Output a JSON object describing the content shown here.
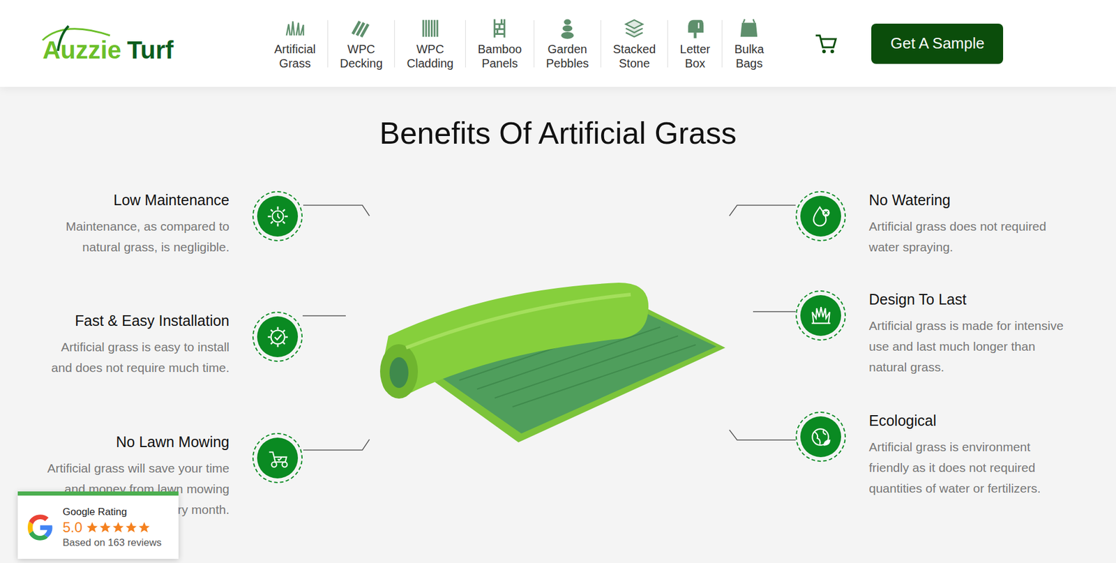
{
  "logo": {
    "name": "Auzzie",
    "accent": "Turf"
  },
  "nav": [
    {
      "label": "Artificial Grass"
    },
    {
      "label": "WPC Decking"
    },
    {
      "label": "WPC Cladding"
    },
    {
      "label": "Bamboo Panels"
    },
    {
      "label": "Garden Pebbles"
    },
    {
      "label": "Stacked Stone"
    },
    {
      "label": "Letter Box"
    },
    {
      "label": "Bulka Bags"
    }
  ],
  "cta": "Get A Sample",
  "title": "Benefits Of Artificial Grass",
  "left": [
    {
      "title": "Low Maintenance",
      "desc": "Maintenance, as compared to natural grass, is negligible."
    },
    {
      "title": "Fast & Easy Installation",
      "desc": "Artificial grass is easy to install and does not require much time."
    },
    {
      "title": "No Lawn Mowing",
      "desc": "Artificial grass will save your time and money from lawn mowing every month."
    }
  ],
  "right": [
    {
      "title": "No Watering",
      "desc": "Artificial grass does not required water spraying."
    },
    {
      "title": "Design To Last",
      "desc": "Artificial grass is made for intensive use and last much longer than natural grass."
    },
    {
      "title": "Ecological",
      "desc": "Artificial grass is environment friendly as it does not required quantities of water or fertilizers."
    }
  ],
  "badge": {
    "label": "Google Rating",
    "score": "5.0",
    "stars": 5,
    "reviews": "Based on 163 reviews"
  }
}
